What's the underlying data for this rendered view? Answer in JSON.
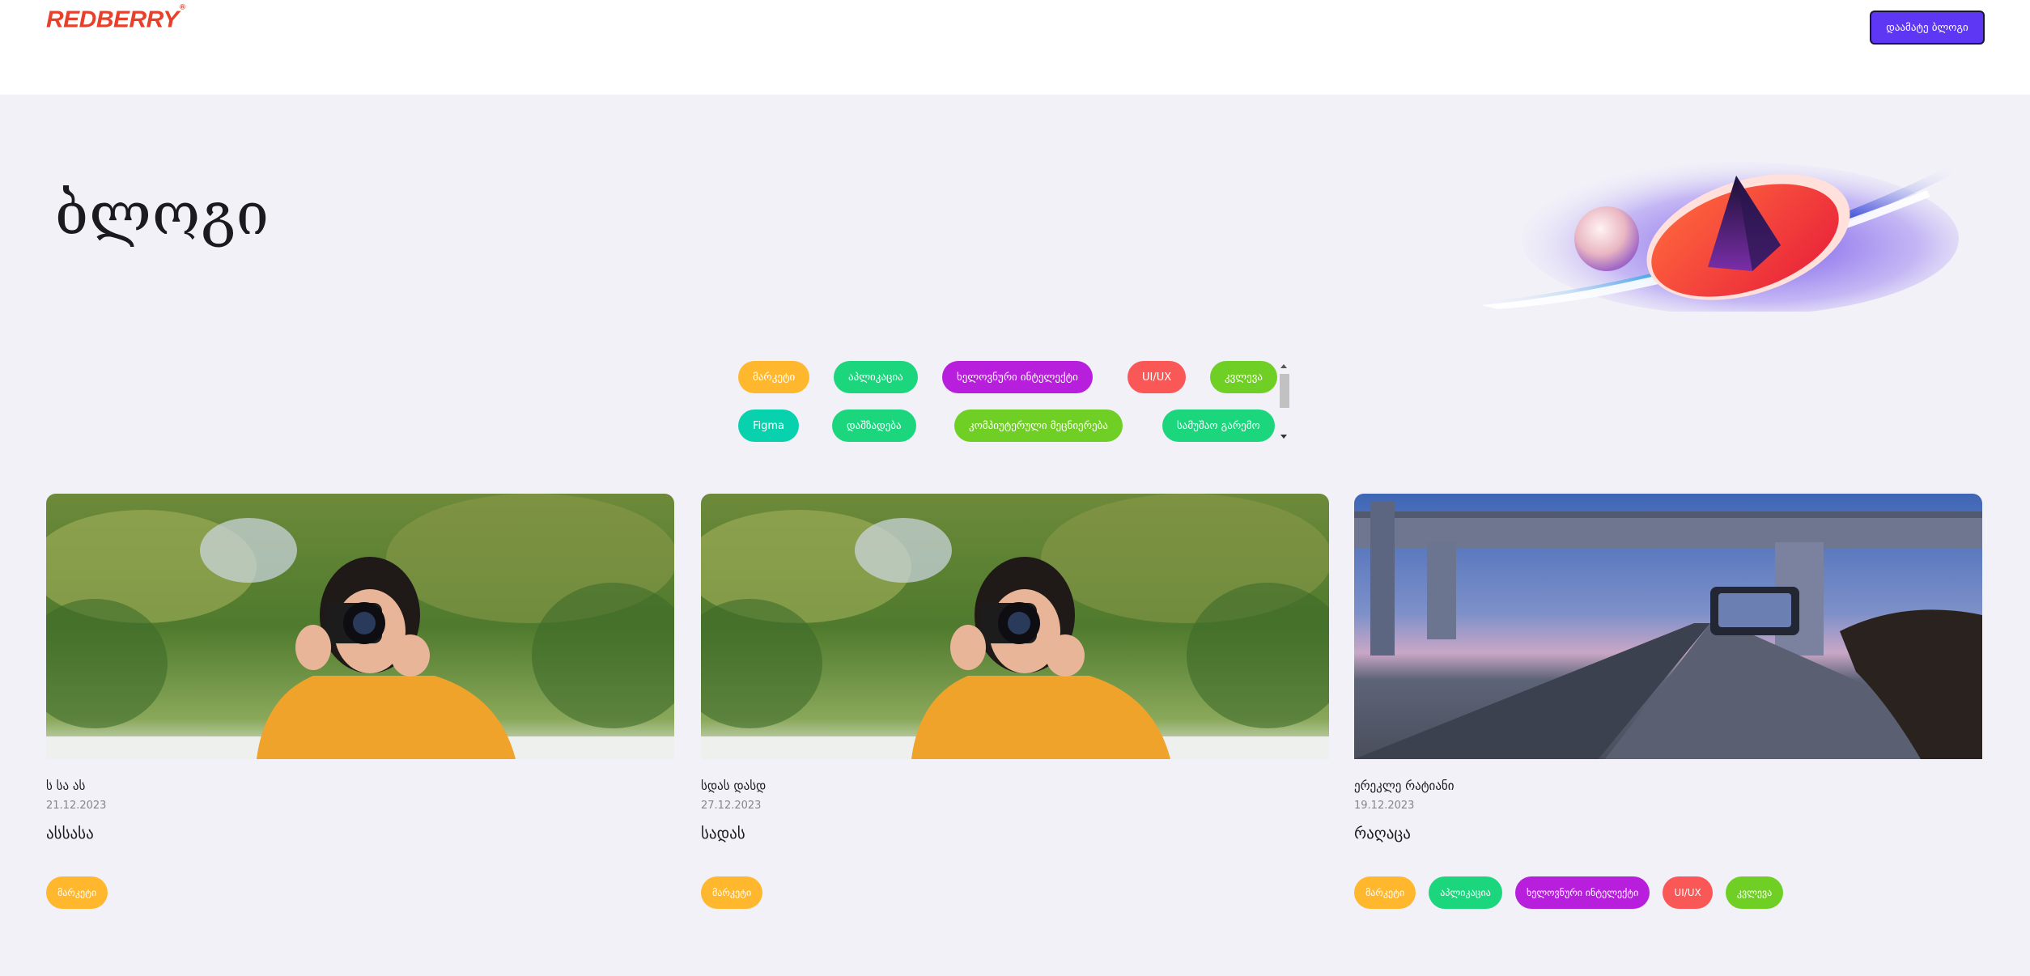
{
  "header": {
    "logo": "REDBERRY",
    "logo_mark": "®",
    "add_blog_label": "დაამატე ბლოგი"
  },
  "page_title": "ბლოგი",
  "filters": [
    {
      "label": "მარკეტი",
      "color": "#ffb82e"
    },
    {
      "label": "აპლიკაცია",
      "color": "#1cd67d"
    },
    {
      "label": "ხელოვნური ინტელექტი",
      "color": "#b71fdd"
    },
    {
      "label": "UI/UX",
      "color": "#fa5757"
    },
    {
      "label": "კვლევა",
      "color": "#70cf25"
    },
    {
      "label": "Figma",
      "color": "#08d2ae"
    },
    {
      "label": "დაშზადება",
      "color": "#1cd67d"
    },
    {
      "label": "კომპიუტერული მეცნიერება",
      "color": "#70cf25"
    },
    {
      "label": "სამუშაო გარემო",
      "color": "#1cd67d"
    }
  ],
  "cards": [
    {
      "author": "ს სა ას",
      "date": "21.12.2023",
      "title": "ასსასა",
      "image": "photographer-icon",
      "tags": [
        {
          "label": "მარკეტი",
          "color": "#ffb82e"
        }
      ]
    },
    {
      "author": "სდას დასდ",
      "date": "27.12.2023",
      "title": "სადას",
      "image": "photographer-icon",
      "tags": [
        {
          "label": "მარკეტი",
          "color": "#ffb82e"
        }
      ]
    },
    {
      "author": "ერეკლე რატიანი",
      "date": "19.12.2023",
      "title": "რაღაცა",
      "image": "bridge-photo-icon",
      "tags": [
        {
          "label": "მარკეტი",
          "color": "#ffb82e"
        },
        {
          "label": "აპლიკაცია",
          "color": "#1cd67d"
        },
        {
          "label": "ხელოვნური ინტელექტი",
          "color": "#b71fdd"
        },
        {
          "label": "UI/UX",
          "color": "#fa5757"
        },
        {
          "label": "კვლევა",
          "color": "#70cf25"
        }
      ]
    }
  ]
}
